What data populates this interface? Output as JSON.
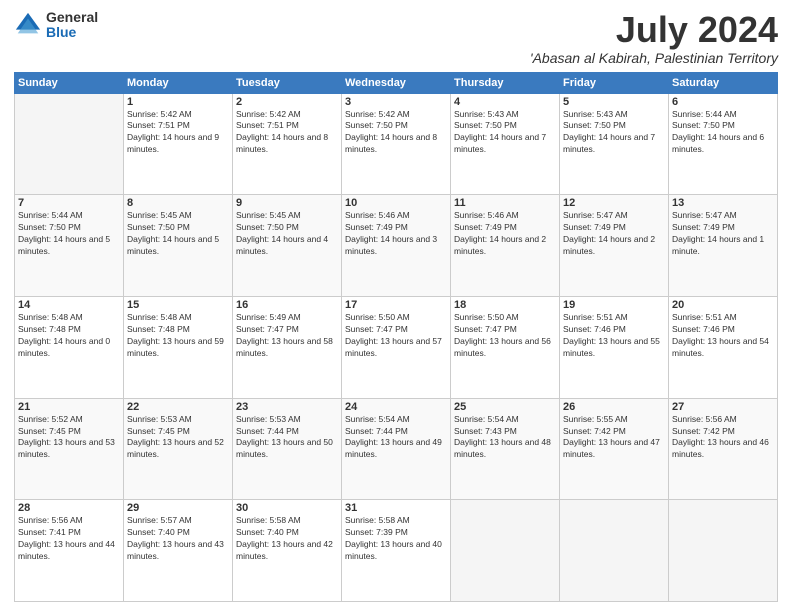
{
  "logo": {
    "general": "General",
    "blue": "Blue"
  },
  "header": {
    "month": "July 2024",
    "location": "'Abasan al Kabirah, Palestinian Territory"
  },
  "weekdays": [
    "Sunday",
    "Monday",
    "Tuesday",
    "Wednesday",
    "Thursday",
    "Friday",
    "Saturday"
  ],
  "weeks": [
    [
      {
        "day": "",
        "empty": true
      },
      {
        "day": "1",
        "sunrise": "5:42 AM",
        "sunset": "7:51 PM",
        "daylight": "14 hours and 9 minutes."
      },
      {
        "day": "2",
        "sunrise": "5:42 AM",
        "sunset": "7:51 PM",
        "daylight": "14 hours and 8 minutes."
      },
      {
        "day": "3",
        "sunrise": "5:42 AM",
        "sunset": "7:50 PM",
        "daylight": "14 hours and 8 minutes."
      },
      {
        "day": "4",
        "sunrise": "5:43 AM",
        "sunset": "7:50 PM",
        "daylight": "14 hours and 7 minutes."
      },
      {
        "day": "5",
        "sunrise": "5:43 AM",
        "sunset": "7:50 PM",
        "daylight": "14 hours and 7 minutes."
      },
      {
        "day": "6",
        "sunrise": "5:44 AM",
        "sunset": "7:50 PM",
        "daylight": "14 hours and 6 minutes."
      }
    ],
    [
      {
        "day": "7",
        "sunrise": "5:44 AM",
        "sunset": "7:50 PM",
        "daylight": "14 hours and 5 minutes."
      },
      {
        "day": "8",
        "sunrise": "5:45 AM",
        "sunset": "7:50 PM",
        "daylight": "14 hours and 5 minutes."
      },
      {
        "day": "9",
        "sunrise": "5:45 AM",
        "sunset": "7:50 PM",
        "daylight": "14 hours and 4 minutes."
      },
      {
        "day": "10",
        "sunrise": "5:46 AM",
        "sunset": "7:49 PM",
        "daylight": "14 hours and 3 minutes."
      },
      {
        "day": "11",
        "sunrise": "5:46 AM",
        "sunset": "7:49 PM",
        "daylight": "14 hours and 2 minutes."
      },
      {
        "day": "12",
        "sunrise": "5:47 AM",
        "sunset": "7:49 PM",
        "daylight": "14 hours and 2 minutes."
      },
      {
        "day": "13",
        "sunrise": "5:47 AM",
        "sunset": "7:49 PM",
        "daylight": "14 hours and 1 minute."
      }
    ],
    [
      {
        "day": "14",
        "sunrise": "5:48 AM",
        "sunset": "7:48 PM",
        "daylight": "14 hours and 0 minutes."
      },
      {
        "day": "15",
        "sunrise": "5:48 AM",
        "sunset": "7:48 PM",
        "daylight": "13 hours and 59 minutes."
      },
      {
        "day": "16",
        "sunrise": "5:49 AM",
        "sunset": "7:47 PM",
        "daylight": "13 hours and 58 minutes."
      },
      {
        "day": "17",
        "sunrise": "5:50 AM",
        "sunset": "7:47 PM",
        "daylight": "13 hours and 57 minutes."
      },
      {
        "day": "18",
        "sunrise": "5:50 AM",
        "sunset": "7:47 PM",
        "daylight": "13 hours and 56 minutes."
      },
      {
        "day": "19",
        "sunrise": "5:51 AM",
        "sunset": "7:46 PM",
        "daylight": "13 hours and 55 minutes."
      },
      {
        "day": "20",
        "sunrise": "5:51 AM",
        "sunset": "7:46 PM",
        "daylight": "13 hours and 54 minutes."
      }
    ],
    [
      {
        "day": "21",
        "sunrise": "5:52 AM",
        "sunset": "7:45 PM",
        "daylight": "13 hours and 53 minutes."
      },
      {
        "day": "22",
        "sunrise": "5:53 AM",
        "sunset": "7:45 PM",
        "daylight": "13 hours and 52 minutes."
      },
      {
        "day": "23",
        "sunrise": "5:53 AM",
        "sunset": "7:44 PM",
        "daylight": "13 hours and 50 minutes."
      },
      {
        "day": "24",
        "sunrise": "5:54 AM",
        "sunset": "7:44 PM",
        "daylight": "13 hours and 49 minutes."
      },
      {
        "day": "25",
        "sunrise": "5:54 AM",
        "sunset": "7:43 PM",
        "daylight": "13 hours and 48 minutes."
      },
      {
        "day": "26",
        "sunrise": "5:55 AM",
        "sunset": "7:42 PM",
        "daylight": "13 hours and 47 minutes."
      },
      {
        "day": "27",
        "sunrise": "5:56 AM",
        "sunset": "7:42 PM",
        "daylight": "13 hours and 46 minutes."
      }
    ],
    [
      {
        "day": "28",
        "sunrise": "5:56 AM",
        "sunset": "7:41 PM",
        "daylight": "13 hours and 44 minutes."
      },
      {
        "day": "29",
        "sunrise": "5:57 AM",
        "sunset": "7:40 PM",
        "daylight": "13 hours and 43 minutes."
      },
      {
        "day": "30",
        "sunrise": "5:58 AM",
        "sunset": "7:40 PM",
        "daylight": "13 hours and 42 minutes."
      },
      {
        "day": "31",
        "sunrise": "5:58 AM",
        "sunset": "7:39 PM",
        "daylight": "13 hours and 40 minutes."
      },
      {
        "day": "",
        "empty": true
      },
      {
        "day": "",
        "empty": true
      },
      {
        "day": "",
        "empty": true
      }
    ]
  ]
}
